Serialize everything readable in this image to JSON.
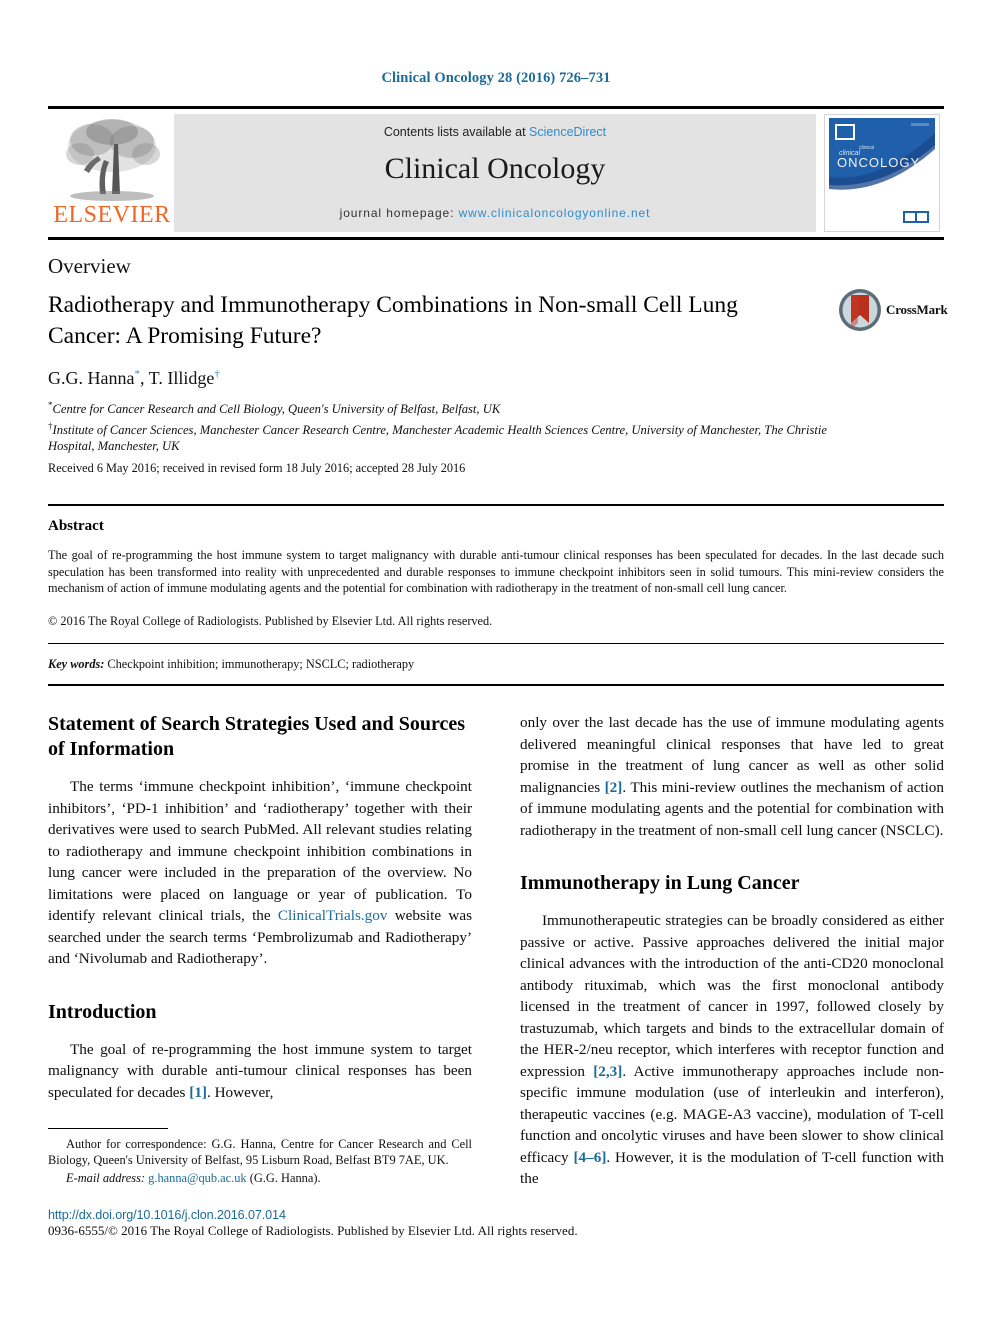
{
  "running_head": "Clinical Oncology 28 (2016) 726–731",
  "masthead": {
    "publisher_name": "ELSEVIER",
    "contents_prefix": "Contents lists available at ",
    "contents_link": "ScienceDirect",
    "journal_title": "Clinical Oncology",
    "homepage_prefix": "journal homepage: ",
    "homepage_url": "www.clinicaloncologyonline.net",
    "cover_journal_line1": "clinical",
    "cover_journal_line2": "ONCOLOGY"
  },
  "article": {
    "type": "Overview",
    "title": "Radiotherapy and Immunotherapy Combinations in Non-small Cell Lung Cancer: A Promising Future?",
    "crossmark_label": "CrossMark",
    "authors": "G.G. Hanna , T. Illidge ",
    "author_1": "G.G. Hanna",
    "author_1_mark": "*",
    "author_2": "T. Illidge",
    "author_2_mark": "†",
    "affiliation_1_mark": "*",
    "affiliation_1": "Centre for Cancer Research and Cell Biology, Queen's University of Belfast, Belfast, UK",
    "affiliation_2_mark": "†",
    "affiliation_2": "Institute of Cancer Sciences, Manchester Cancer Research Centre, Manchester Academic Health Sciences Centre, University of Manchester, The Christie Hospital, Manchester, UK",
    "history": "Received 6 May 2016; received in revised form 18 July 2016; accepted 28 July 2016"
  },
  "abstract": {
    "heading": "Abstract",
    "body": "The goal of re-programming the host immune system to target malignancy with durable anti-tumour clinical responses has been speculated for decades. In the last decade such speculation has been transformed into reality with unprecedented and durable responses to immune checkpoint inhibitors seen in solid tumours. This mini-review considers the mechanism of action of immune modulating agents and the potential for combination with radiotherapy in the treatment of non-small cell lung cancer.",
    "copyright": "© 2016 The Royal College of Radiologists. Published by Elsevier Ltd. All rights reserved."
  },
  "keywords": {
    "label": "Key words:",
    "value": " Checkpoint inhibition; immunotherapy; NSCLC; radiotherapy"
  },
  "left_column": {
    "section_1_heading": "Statement of Search Strategies Used and Sources of Information",
    "section_1_para_part1": "The terms ‘immune checkpoint inhibition’, ‘immune checkpoint inhibitors’, ‘PD-1 inhibition’ and ‘radiotherapy’ together with their derivatives were used to search PubMed. All relevant studies relating to radiotherapy and immune checkpoint inhibition combinations in lung cancer were included in the preparation of the overview. No limitations were placed on language or year of publication. To identify relevant clinical trials, the ",
    "section_1_link": "ClinicalTrials.gov",
    "section_1_para_part2": " website was searched under the search terms ‘Pembrolizumab and Radiotherapy’ and ‘Nivolumab and Radiotherapy’.",
    "section_2_heading": "Introduction",
    "section_2_para_part1": "The goal of re-programming the host immune system to target malignancy with durable anti-tumour clinical responses has been speculated for decades ",
    "section_2_ref": "[1]",
    "section_2_para_part2": ". However,"
  },
  "right_column": {
    "continued_part1": "only over the last decade has the use of immune modulating agents delivered meaningful clinical responses that have led to great promise in the treatment of lung cancer as well as other solid malignancies ",
    "continued_ref": "[2]",
    "continued_part2": ". This mini-review outlines the mechanism of action of immune modulating agents and the potential for combination with radiotherapy in the treatment of non-small cell lung cancer (NSCLC).",
    "section_3_heading": "Immunotherapy in Lung Cancer",
    "section_3_part1": "Immunotherapeutic strategies can be broadly considered as either passive or active. Passive approaches delivered the initial major clinical advances with the introduction of the anti-CD20 monoclonal antibody rituximab, which was the first monoclonal antibody licensed in the treatment of cancer in 1997, followed closely by trastuzumab, which targets and binds to the extracellular domain of the HER-2/neu receptor, which interferes with receptor function and expression ",
    "section_3_ref1": "[2,3]",
    "section_3_part2": ". Active immunotherapy approaches include non-specific immune modulation (use of interleukin and interferon), therapeutic vaccines (e.g. MAGE-A3 vaccine), modulation of T-cell function and oncolytic viruses and have been slower to show clinical efficacy ",
    "section_3_ref2": "[4–6]",
    "section_3_part3": ". However, it is the modulation of T-cell function with the"
  },
  "footnote": {
    "correspondence": "Author for correspondence: G.G. Hanna, Centre for Cancer Research and Cell Biology, Queen's University of Belfast, 95 Lisburn Road, Belfast BT9 7AE, UK.",
    "email_label": "E-mail address:",
    "email_address": "g.hanna@qub.ac.uk",
    "email_suffix": " (G.G. Hanna)."
  },
  "page_footer": {
    "doi": "http://dx.doi.org/10.1016/j.clon.2016.07.014",
    "issn_copyright": "0936-6555/© 2016 The Royal College of Radiologists. Published by Elsevier Ltd. All rights reserved."
  },
  "colors": {
    "link_blue": "#1a6b9a",
    "science_direct_blue": "#2b8ccc",
    "elsevier_orange": "#F26522",
    "band_grey": "#e3e3e3",
    "cover_blue": "#1f5fa9"
  }
}
